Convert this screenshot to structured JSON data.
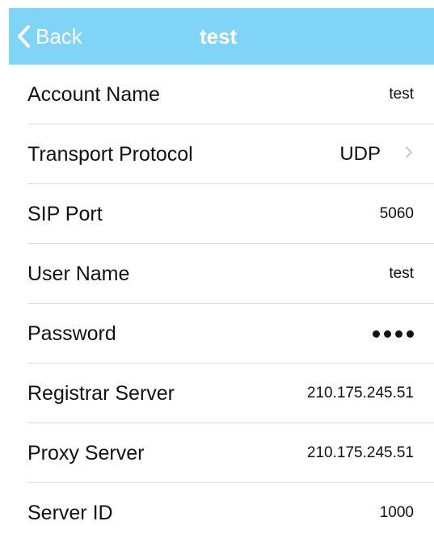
{
  "navbar": {
    "back_label": "Back",
    "title": "test",
    "color": "#7fd4f8",
    "back_icon": "chevron-left-icon"
  },
  "fields": {
    "account_name": {
      "label": "Account Name",
      "value": "test"
    },
    "transport_protocol": {
      "label": "Transport Protocol",
      "value": "UDP",
      "icon": "chevron-right-icon"
    },
    "sip_port": {
      "label": "SIP Port",
      "value": "5060"
    },
    "user_name": {
      "label": "User Name",
      "value": "test"
    },
    "password": {
      "label": "Password",
      "masked_length": 4
    },
    "registrar_server": {
      "label": "Registrar Server",
      "value": "210.175.245.51"
    },
    "proxy_server": {
      "label": "Proxy Server",
      "value": "210.175.245.51"
    },
    "server_id": {
      "label": "Server ID",
      "value": "1000"
    }
  }
}
